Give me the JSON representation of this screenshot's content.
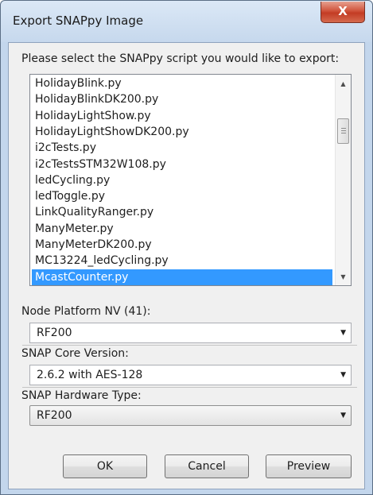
{
  "window": {
    "title": "Export SNAPpy Image",
    "close_glyph": "X"
  },
  "script_list": {
    "label": "Please select the SNAPpy script you would like to export:",
    "items": [
      "HolidayBlink.py",
      "HolidayBlinkDK200.py",
      "HolidayLightShow.py",
      "HolidayLightShowDK200.py",
      "i2cTests.py",
      "i2cTestsSTM32W108.py",
      "ledCycling.py",
      "ledToggle.py",
      "LinkQualityRanger.py",
      "ManyMeter.py",
      "ManyMeterDK200.py",
      "MC13224_ledCycling.py",
      "McastCounter.py"
    ],
    "selected": "McastCounter.py",
    "scroll_up_icon": "triangle-up",
    "scroll_down_icon": "triangle-down"
  },
  "node_platform": {
    "label": "Node Platform NV (41):",
    "value": "RF200"
  },
  "core_version": {
    "label": "SNAP Core Version:",
    "value": "2.6.2 with AES-128"
  },
  "hardware_type": {
    "label": "SNAP Hardware Type:",
    "value": "RF200"
  },
  "buttons": {
    "ok": "OK",
    "cancel": "Cancel",
    "preview": "Preview"
  },
  "colors": {
    "selection": "#3399ff",
    "close_button": "#c9432b",
    "frame": "#c3d6ec"
  }
}
